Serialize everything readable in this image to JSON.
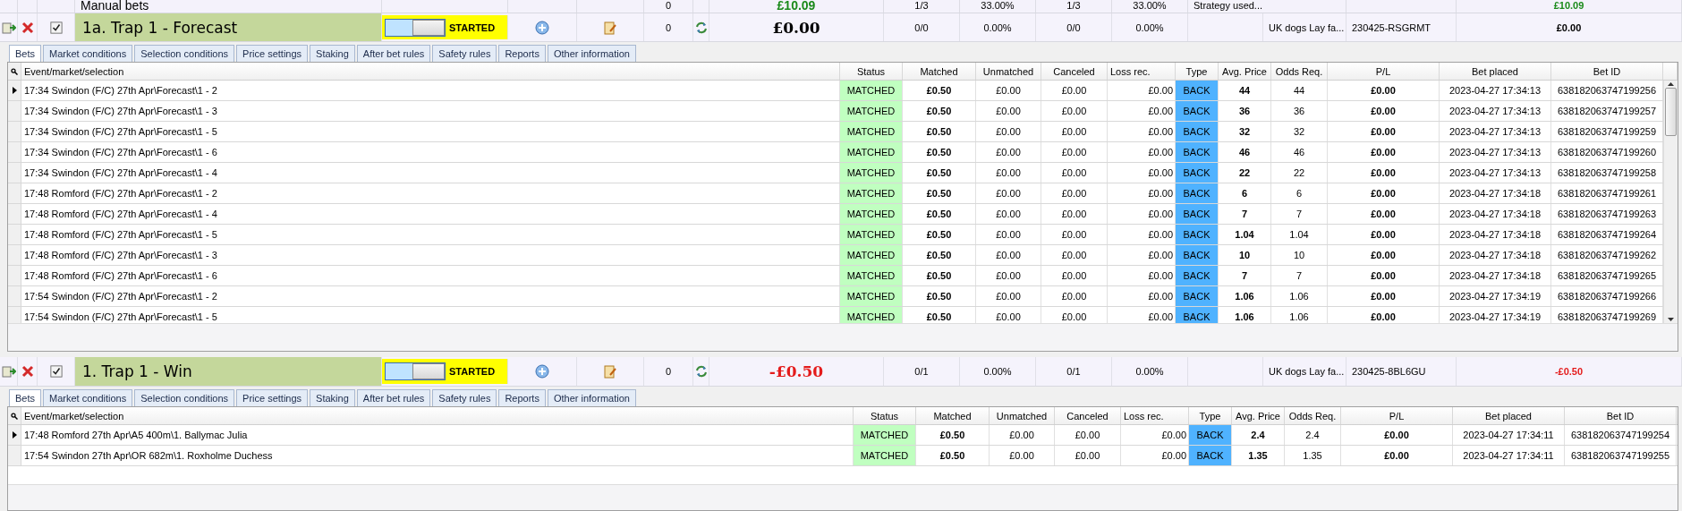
{
  "manual_row": {
    "name": "Manual bets",
    "count": "0",
    "amount": "£10.09",
    "cells": [
      "1/3",
      "33.00%",
      "1/3",
      "33.00%",
      "Strategy used..."
    ],
    "profit": "£10.09"
  },
  "strategies": [
    {
      "enabled": true,
      "name": "1a. Trap 1 - Forecast",
      "toggle_on": false,
      "state": "STARTED",
      "count": "0",
      "amount": "£0.00",
      "amount_negative": false,
      "cells": [
        "0/0",
        "0.00%",
        "0/0",
        "0.00%"
      ],
      "strategy": "UK dogs Lay fa...",
      "code": "230425-RSGRMT",
      "profit": "£0.00",
      "profit_negative": false,
      "tabs": [
        {
          "label": "Bets",
          "selected": true
        },
        {
          "label": "Market conditions",
          "selected": false
        },
        {
          "label": "Selection conditions",
          "selected": false
        },
        {
          "label": "Price settings",
          "selected": false
        },
        {
          "label": "Staking",
          "selected": false
        },
        {
          "label": "After bet rules",
          "selected": false
        },
        {
          "label": "Safety rules",
          "selected": false
        },
        {
          "label": "Reports",
          "selected": false
        },
        {
          "label": "Other information",
          "selected": false
        }
      ],
      "columns": [
        "Event/market/selection",
        "Status",
        "Matched",
        "Unmatched",
        "Canceled",
        "Loss rec.",
        "Type",
        "Avg. Price",
        "Odds Req.",
        "P/L",
        "Bet placed",
        "Bet ID"
      ],
      "scrollbar": true,
      "rows": [
        {
          "current": true,
          "event": "17:34 Swindon (F/C) 27th Apr\\Forecast\\1 - 2",
          "status": "MATCHED",
          "matched": "£0.50",
          "unmatched": "£0.00",
          "canceled": "£0.00",
          "loss": "£0.00",
          "type": "BACK",
          "avg": "44",
          "odds": "44",
          "pl": "£0.00",
          "placed": "2023-04-27 17:34:13",
          "bet_id": "638182063747199256"
        },
        {
          "current": false,
          "event": "17:34 Swindon (F/C) 27th Apr\\Forecast\\1 - 3",
          "status": "MATCHED",
          "matched": "£0.50",
          "unmatched": "£0.00",
          "canceled": "£0.00",
          "loss": "£0.00",
          "type": "BACK",
          "avg": "36",
          "odds": "36",
          "pl": "£0.00",
          "placed": "2023-04-27 17:34:13",
          "bet_id": "638182063747199257"
        },
        {
          "current": false,
          "event": "17:34 Swindon (F/C) 27th Apr\\Forecast\\1 - 5",
          "status": "MATCHED",
          "matched": "£0.50",
          "unmatched": "£0.00",
          "canceled": "£0.00",
          "loss": "£0.00",
          "type": "BACK",
          "avg": "32",
          "odds": "32",
          "pl": "£0.00",
          "placed": "2023-04-27 17:34:13",
          "bet_id": "638182063747199259"
        },
        {
          "current": false,
          "event": "17:34 Swindon (F/C) 27th Apr\\Forecast\\1 - 6",
          "status": "MATCHED",
          "matched": "£0.50",
          "unmatched": "£0.00",
          "canceled": "£0.00",
          "loss": "£0.00",
          "type": "BACK",
          "avg": "46",
          "odds": "46",
          "pl": "£0.00",
          "placed": "2023-04-27 17:34:13",
          "bet_id": "638182063747199260"
        },
        {
          "current": false,
          "event": "17:34 Swindon (F/C) 27th Apr\\Forecast\\1 - 4",
          "status": "MATCHED",
          "matched": "£0.50",
          "unmatched": "£0.00",
          "canceled": "£0.00",
          "loss": "£0.00",
          "type": "BACK",
          "avg": "22",
          "odds": "22",
          "pl": "£0.00",
          "placed": "2023-04-27 17:34:13",
          "bet_id": "638182063747199258"
        },
        {
          "current": false,
          "event": "17:48 Romford (F/C) 27th Apr\\Forecast\\1 - 2",
          "status": "MATCHED",
          "matched": "£0.50",
          "unmatched": "£0.00",
          "canceled": "£0.00",
          "loss": "£0.00",
          "type": "BACK",
          "avg": "6",
          "odds": "6",
          "pl": "£0.00",
          "placed": "2023-04-27 17:34:18",
          "bet_id": "638182063747199261"
        },
        {
          "current": false,
          "event": "17:48 Romford (F/C) 27th Apr\\Forecast\\1 - 4",
          "status": "MATCHED",
          "matched": "£0.50",
          "unmatched": "£0.00",
          "canceled": "£0.00",
          "loss": "£0.00",
          "type": "BACK",
          "avg": "7",
          "odds": "7",
          "pl": "£0.00",
          "placed": "2023-04-27 17:34:18",
          "bet_id": "638182063747199263"
        },
        {
          "current": false,
          "event": "17:48 Romford (F/C) 27th Apr\\Forecast\\1 - 5",
          "status": "MATCHED",
          "matched": "£0.50",
          "unmatched": "£0.00",
          "canceled": "£0.00",
          "loss": "£0.00",
          "type": "BACK",
          "avg": "1.04",
          "odds": "1.04",
          "pl": "£0.00",
          "placed": "2023-04-27 17:34:18",
          "bet_id": "638182063747199264"
        },
        {
          "current": false,
          "event": "17:48 Romford (F/C) 27th Apr\\Forecast\\1 - 3",
          "status": "MATCHED",
          "matched": "£0.50",
          "unmatched": "£0.00",
          "canceled": "£0.00",
          "loss": "£0.00",
          "type": "BACK",
          "avg": "10",
          "odds": "10",
          "pl": "£0.00",
          "placed": "2023-04-27 17:34:18",
          "bet_id": "638182063747199262"
        },
        {
          "current": false,
          "event": "17:48 Romford (F/C) 27th Apr\\Forecast\\1 - 6",
          "status": "MATCHED",
          "matched": "£0.50",
          "unmatched": "£0.00",
          "canceled": "£0.00",
          "loss": "£0.00",
          "type": "BACK",
          "avg": "7",
          "odds": "7",
          "pl": "£0.00",
          "placed": "2023-04-27 17:34:18",
          "bet_id": "638182063747199265"
        },
        {
          "current": false,
          "event": "17:54 Swindon (F/C) 27th Apr\\Forecast\\1 - 2",
          "status": "MATCHED",
          "matched": "£0.50",
          "unmatched": "£0.00",
          "canceled": "£0.00",
          "loss": "£0.00",
          "type": "BACK",
          "avg": "1.06",
          "odds": "1.06",
          "pl": "£0.00",
          "placed": "2023-04-27 17:34:19",
          "bet_id": "638182063747199266"
        },
        {
          "current": false,
          "event": "17:54 Swindon (F/C) 27th Apr\\Forecast\\1 - 5",
          "status": "MATCHED",
          "matched": "£0.50",
          "unmatched": "£0.00",
          "canceled": "£0.00",
          "loss": "£0.00",
          "type": "BACK",
          "avg": "1.06",
          "odds": "1.06",
          "pl": "£0.00",
          "placed": "2023-04-27 17:34:19",
          "bet_id": "638182063747199269"
        }
      ]
    },
    {
      "enabled": true,
      "name": "1. Trap 1 - Win",
      "toggle_on": false,
      "state": "STARTED",
      "count": "0",
      "amount": "-£0.50",
      "amount_negative": true,
      "cells": [
        "0/1",
        "0.00%",
        "0/1",
        "0.00%"
      ],
      "strategy": "UK dogs Lay fa...",
      "code": "230425-8BL6GU",
      "profit": "-£0.50",
      "profit_negative": true,
      "tabs": [
        {
          "label": "Bets",
          "selected": true
        },
        {
          "label": "Market conditions",
          "selected": false
        },
        {
          "label": "Selection conditions",
          "selected": false
        },
        {
          "label": "Price settings",
          "selected": false
        },
        {
          "label": "Staking",
          "selected": false
        },
        {
          "label": "After bet rules",
          "selected": false
        },
        {
          "label": "Safety rules",
          "selected": false
        },
        {
          "label": "Reports",
          "selected": false
        },
        {
          "label": "Other information",
          "selected": false
        }
      ],
      "columns": [
        "Event/market/selection",
        "Status",
        "Matched",
        "Unmatched",
        "Canceled",
        "Loss rec.",
        "Type",
        "Avg. Price",
        "Odds Req.",
        "P/L",
        "Bet placed",
        "Bet ID"
      ],
      "scrollbar": false,
      "rows": [
        {
          "current": true,
          "event": "17:48 Romford 27th Apr\\A5 400m\\1. Ballymac Julia",
          "status": "MATCHED",
          "matched": "£0.50",
          "unmatched": "£0.00",
          "canceled": "£0.00",
          "loss": "£0.00",
          "type": "BACK",
          "avg": "2.4",
          "odds": "2.4",
          "pl": "£0.00",
          "placed": "2023-04-27 17:34:11",
          "bet_id": "638182063747199254"
        },
        {
          "current": false,
          "event": "17:54 Swindon 27th Apr\\OR 682m\\1. Roxholme Duchess",
          "status": "MATCHED",
          "matched": "£0.50",
          "unmatched": "£0.00",
          "canceled": "£0.00",
          "loss": "£0.00",
          "type": "BACK",
          "avg": "1.35",
          "odds": "1.35",
          "pl": "£0.00",
          "placed": "2023-04-27 17:34:11",
          "bet_id": "638182063747199255"
        }
      ]
    }
  ]
}
